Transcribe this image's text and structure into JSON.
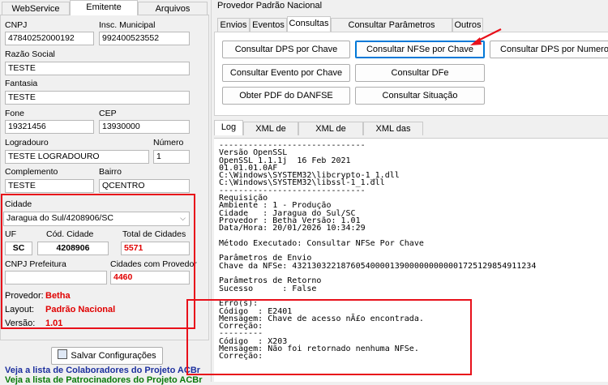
{
  "left_tabs": [
    "WebService",
    "Emitente",
    "Arquivos"
  ],
  "fields": {
    "cnpj_label": "CNPJ",
    "cnpj": "47840252000192",
    "insc_label": "Insc. Municipal",
    "insc": "992400523552",
    "razao_label": "Razão Social",
    "razao": "TESTE",
    "fantasia_label": "Fantasia",
    "fantasia": "TESTE",
    "fone_label": "Fone",
    "fone": "19321456",
    "cep_label": "CEP",
    "cep": "13930000",
    "logradouro_label": "Logradouro",
    "logradouro": "TESTE LOGRADOURO",
    "numero_label": "Número",
    "numero": "1",
    "complemento_label": "Complemento",
    "complemento": "TESTE",
    "bairro_label": "Bairro",
    "bairro": "QCENTRO",
    "cidade_label": "Cidade",
    "cidade": "Jaragua do Sul/4208906/SC",
    "uf_label": "UF",
    "uf": "SC",
    "cod_cidade_label": "Cód. Cidade",
    "cod_cidade": "4208906",
    "total_cidades_label": "Total de Cidades",
    "total_cidades": "5571",
    "cnpj_prefeitura_label": "CNPJ Prefeitura",
    "cnpj_prefeitura": "",
    "cidades_provedor_label": "Cidades com Provedor",
    "cidades_provedor": "4460"
  },
  "provider": {
    "provedor_label": "Provedor:",
    "provedor": "Betha",
    "layout_label": "Layout:",
    "layout": "Padrão Nacional",
    "versao_label": "Versão:",
    "versao": "1.01"
  },
  "save_button": "Salvar Configurações",
  "links": [
    "Veja a lista de Colaboradores do Projeto ACBr",
    "Veja a lista de Patrocinadores do Projeto ACBr"
  ],
  "group_title": "Provedor Padrão Nacional",
  "right_tabs": [
    "Envios",
    "Eventos",
    "Consultas",
    "Consultar Parâmetros Municipais",
    "Outros"
  ],
  "buttons": {
    "dps_chave": "Consultar DPS por Chave",
    "nfse_chave": "Consultar NFSe por Chave",
    "dps_numero": "Consultar DPS por Numero",
    "evento_chave": "Consultar Evento por Chave",
    "dfe": "Consultar DFe",
    "pdf": "Obter PDF do DANFSE",
    "situacao": "Consultar Situação"
  },
  "log_tabs": [
    "Log",
    "XML de Envio",
    "XML de Retorno",
    "XML das Notas"
  ],
  "log_lines": [
    "------------------------------",
    "Versão OpenSSL",
    "OpenSSL 1.1.1j  16 Feb 2021",
    "01.01.01.0AF",
    "C:\\Windows\\SYSTEM32\\libcrypto-1_1.dll",
    "C:\\Windows\\SYSTEM32\\libssl-1_1.dll",
    "------------------------------",
    "Requisição",
    "Ambiente : 1 - Produção",
    "Cidade   : Jaragua do Sul/SC",
    "Provedor : Betha Versão: 1.01",
    "Data/Hora: 20/01/2026 10:34:29",
    "",
    "Método Executado: Consultar NFSe Por Chave",
    "",
    "Parâmetros de Envio",
    "Chave da NFSe: 43213032218760540000139000000000001725129854911234",
    "",
    "Parâmetros de Retorno",
    "Sucesso      : False",
    "",
    "Erro(s):",
    "Código  : E2401",
    "Mensagem: Chave de acesso nÃ£o encontrada.",
    "Correção:",
    "---------",
    "Código  : X203",
    "Mensagem: Não foi retornado nenhuma NFSe.",
    "Correção:"
  ],
  "colors": {
    "highlight_red": "#e8101a",
    "value_red": "#e00000",
    "focus_blue": "#0078d7"
  }
}
